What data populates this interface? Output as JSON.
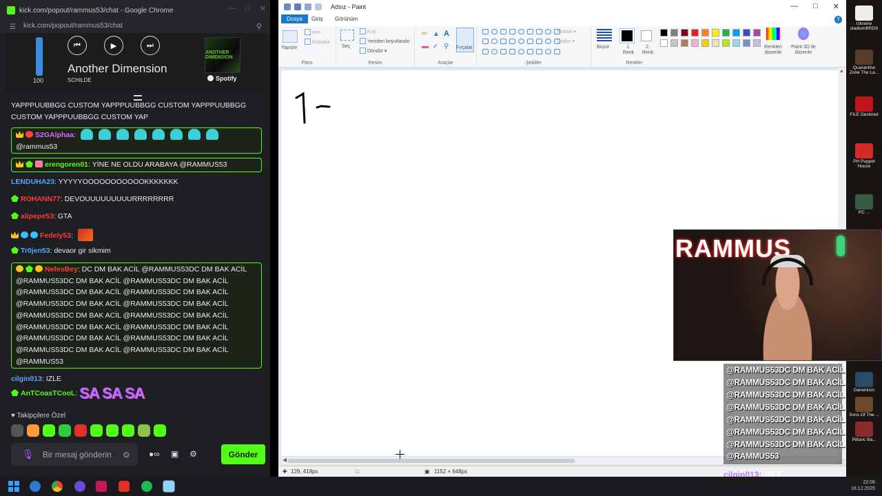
{
  "chrome": {
    "title": "kick.com/popout/rammus53/chat - Google Chrome",
    "url": "kick.com/popout/rammus53/chat"
  },
  "spotify": {
    "volume": 100,
    "volume_label": "100",
    "track": "Another Dimension",
    "artist": "SCHILDE",
    "brand": "Spotify",
    "art_text": "ANOTHER DIMENSION"
  },
  "chat": {
    "messages": [
      {
        "user": "",
        "text": "YAPPPUUBBGG CUSTOM YAPPPUUBBGG CUSTOM YAPPPUUBBGG CUSTOM YAPPPUUBBGG CUSTOM YAP",
        "user_color": "#ffffff"
      },
      {
        "user": "S2GAlphaa",
        "text": "@rammus53",
        "user_color": "#d36bff"
      },
      {
        "user": "erengoren01",
        "text": "YİNE NE OLDU ARABAYA @RAMMUS53",
        "user_color": "#53fc18"
      },
      {
        "user": "LENDUHA23",
        "text": "YYYYYOOOOOOOOOOOKKKKKKK",
        "user_color": "#55a6ff"
      },
      {
        "user": "ROHANN77",
        "text": "DEVOUUUUUUUUURRRRRRRR",
        "user_color": "#ff3a3a"
      },
      {
        "user": "alipepe53",
        "text": "GTA",
        "user_color": "#ff3a3a"
      },
      {
        "user": "Fedely53",
        "text": "",
        "user_color": "#ff3a3a"
      },
      {
        "user": "Tr0jen53",
        "text": "devaor gir sikmim",
        "user_color": "#55a6ff"
      },
      {
        "user": "NefesBey",
        "text": "DC DM BAK ACİL @RAMMUS53DC DM BAK ACİL @RAMMUS53DC DM BAK ACİL @RAMMUS53DC DM BAK ACİL @RAMMUS53DC DM BAK ACİL @RAMMUS53DC DM BAK ACİL @RAMMUS53DC DM BAK ACİL @RAMMUS53DC DM BAK ACİL @RAMMUS53DC DM BAK ACİL @RAMMUS53DC DM BAK ACİL @RAMMUS53DC DM BAK ACİL @RAMMUS53DC DM BAK ACİL @RAMMUS53DC DM BAK ACİL @RAMMUS53DC DM BAK ACİL @RAMMUS53DC DM BAK ACİL @RAMMUS53DC DM BAK ACİL @RAMMUS53",
        "user_color": "#ff3a3a"
      },
      {
        "user": "cilgin013",
        "text": "IZLE",
        "user_color": "#55a6ff"
      },
      {
        "user": "AnTCoasTCooL",
        "text": "SA SA SA",
        "user_color": "#53fc18"
      }
    ],
    "follow_only": "Takipçilere Özel",
    "input_placeholder": "Bir mesaj gönderin",
    "send_label": "Gönder"
  },
  "paint": {
    "title": "Adsız - Paint",
    "tabs": [
      "Dosya",
      "Giriş",
      "Görünüm"
    ],
    "groups": {
      "pano": "Pano",
      "resim": "Resim",
      "araclar": "Araçlar",
      "sekiller": "Şekiller",
      "renkler": "Renkler"
    },
    "ribbon": {
      "yapistir": "Yapıştır",
      "kes": "Kes",
      "kopyala": "Kopyala",
      "sec": "Seç",
      "kirp": "Kırp",
      "yeniden": "Yeniden boyutlandır",
      "dondur": "Döndür",
      "fircalar": "Fırçalar",
      "anahat": "Anahat",
      "doldur": "Doldur",
      "boyut": "Boyut",
      "renk1": "1. Renk",
      "renk2": "2. Renk",
      "renkleri_duzenle": "Renkleri düzenle",
      "paint3d": "Paint 3D ile düzenle"
    },
    "status": {
      "cursor": "129, 418px",
      "size": "1152 × 648px"
    },
    "palette": [
      "#000000",
      "#7f7f7f",
      "#880015",
      "#ed1c24",
      "#ff7f27",
      "#fff200",
      "#22b14c",
      "#00a2e8",
      "#3f48cc",
      "#a349a4",
      "#ffffff",
      "#c3c3c3",
      "#b97a57",
      "#ffaec9",
      "#ffc90e",
      "#efe4b0",
      "#b5e61d",
      "#99d9ea",
      "#7092be",
      "#c8bfe7"
    ]
  },
  "desktop": {
    "icons": [
      "Ukraine stadiumBRDS",
      "Quarantine Zone The La...",
      "FILE Destined",
      "PH Puppet House",
      "PC ...",
      "Darwinism",
      "Sons Of The ...",
      "Pittaric Ba..."
    ]
  },
  "overlay": {
    "lines": [
      "@RAMMUS53DC DM BAK ACİL",
      "@RAMMUS53DC DM BAK ACİL",
      "@RAMMUS53DC DM BAK ACİL",
      "@RAMMUS53DC DM BAK ACİL",
      "@RAMMUS53DC DM BAK ACİL",
      "@RAMMUS53DC DM BAK ACİL",
      "@RAMMUS53DC DM BAK ACİL",
      "@RAMMUS53"
    ],
    "bottom_user": "cilgin013:",
    "bottom_text": "IZLE"
  },
  "webcam": {
    "neon": "RAMMUS"
  },
  "taskbar": {
    "time": "22:06",
    "date": "18.12.2025"
  }
}
